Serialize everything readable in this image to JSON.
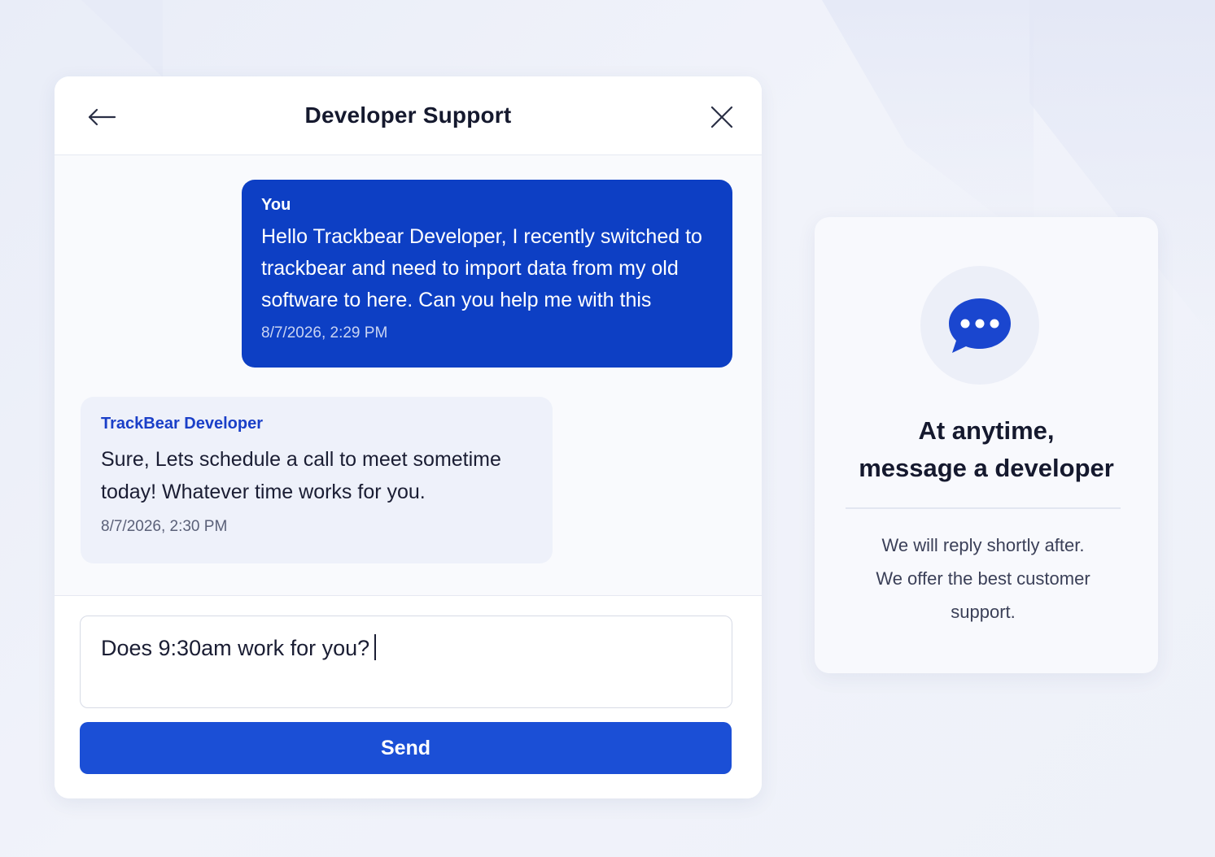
{
  "chat": {
    "title": "Developer Support",
    "messages": [
      {
        "sender": "You",
        "text": "Hello Trackbear Developer, I recently switched to trackbear and need to import data from my old software to here. Can you help me with this",
        "time": "8/7/2026, 2:29 PM"
      },
      {
        "sender": "TrackBear Developer",
        "text": "Sure, Lets schedule a call to meet sometime today! Whatever time works for you.",
        "time": "8/7/2026, 2:30 PM"
      }
    ],
    "input_value": "Does 9:30am work for you?",
    "send_label": "Send"
  },
  "info": {
    "title_line1": "At anytime,",
    "title_line2": "message a developer",
    "text_line1": "We will reply shortly after.",
    "text_line2": "We offer the best customer support."
  },
  "icons": {
    "back": "arrow-left-icon",
    "close": "close-icon",
    "chat": "chat-bubble-icon"
  },
  "colors": {
    "primary": "#0d3fc4",
    "button": "#1b4fd6",
    "accent_text": "#1a3fc8",
    "background": "#eef1f9"
  }
}
